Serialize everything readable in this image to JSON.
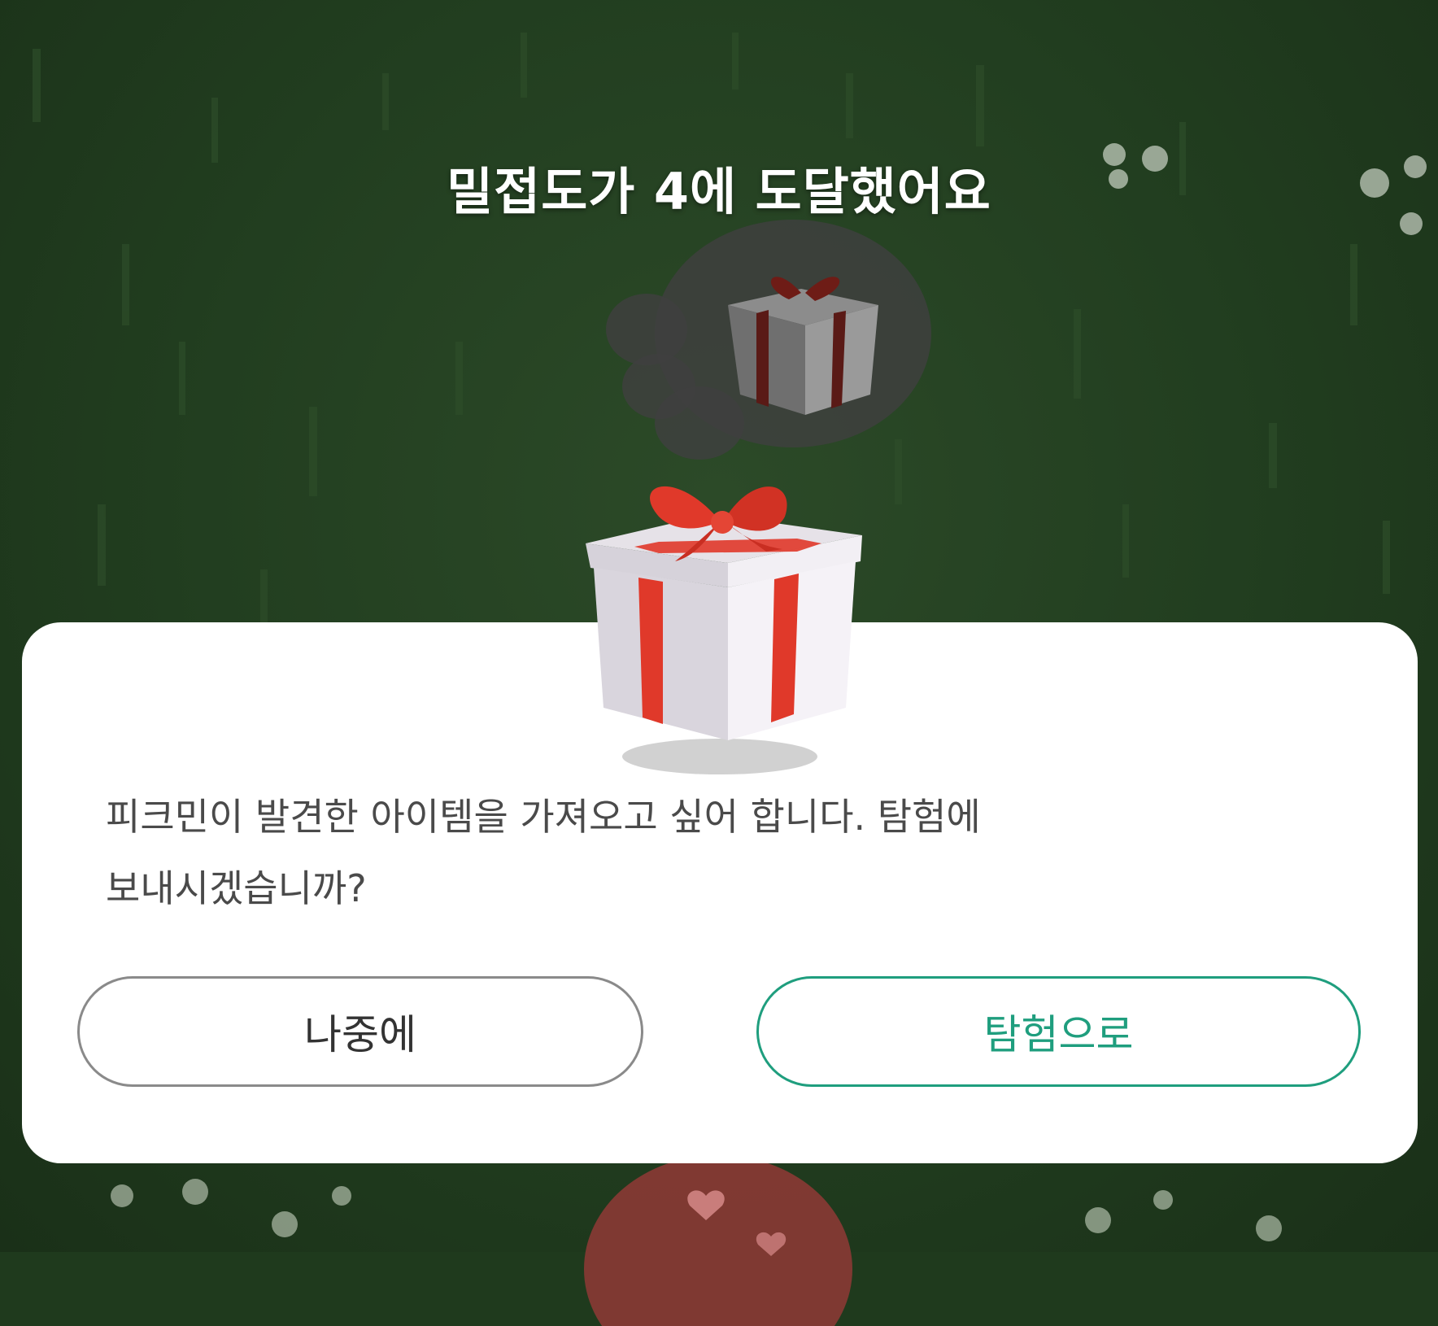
{
  "popup": {
    "title": "밀접도가 4에 도달했어요",
    "message_line1": "피크민이 발견한 아이템을 가져오고 싶어 합니다. 탐험에",
    "message_line2": "보내시겠습니까?",
    "later_button": "나중에",
    "explore_button": "탐험으로"
  },
  "colors": {
    "accent": "#1f9e7e",
    "ribbon": "#e0392a",
    "background": "#213d1f"
  },
  "icons": {
    "gift": "gift-box-icon",
    "thought_gift": "thought-bubble-gift-icon"
  }
}
